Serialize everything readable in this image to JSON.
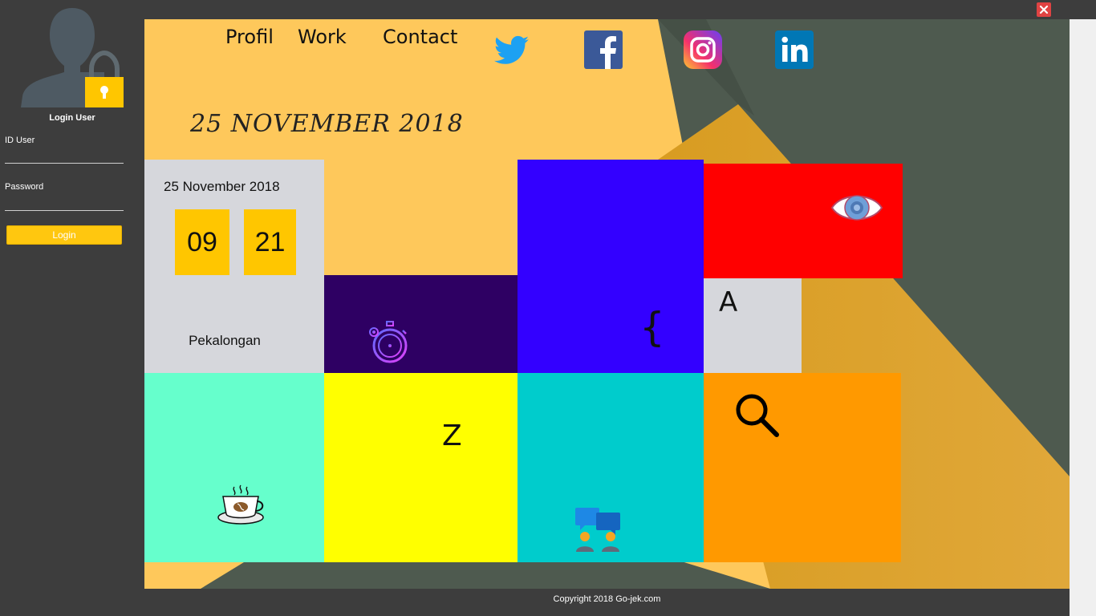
{
  "sidebar": {
    "avatar_icon": "user-lock-icon",
    "title": "Login User",
    "id_label": "ID User",
    "id_value": "",
    "password_label": "Password",
    "password_value": "",
    "login_label": "Login"
  },
  "nav": {
    "profil": "Profil",
    "work": "Work",
    "contact": "Contact"
  },
  "social": [
    "twitter-icon",
    "facebook-icon",
    "instagram-icon",
    "linkedin-icon"
  ],
  "header_date": "25 NOVEMBER 2018",
  "clock": {
    "date": "25 November 2018",
    "hour": "09",
    "minute": "21",
    "city": "Pekalongan"
  },
  "tiles": {
    "stopwatch": {
      "icon": "stopwatch-icon",
      "color": "#2e0063"
    },
    "code": {
      "glyph": "{",
      "color": "#3300ff"
    },
    "eye": {
      "icon": "eye-icon",
      "color": "#ff0000"
    },
    "font": {
      "glyph": "A",
      "color": "#d6d7dc"
    },
    "coffee": {
      "icon": "coffee-cup-icon",
      "color": "#66ffcc"
    },
    "sleep": {
      "glyph": "Z",
      "color": "#ffff00"
    },
    "chat": {
      "icon": "team-chat-icon",
      "color": "#00cccc"
    },
    "search": {
      "icon": "search-icon",
      "color": "#ff9900"
    }
  },
  "colors": {
    "accent": "#ffc600",
    "panel_bg": "#fec85b",
    "sidebar_bg": "#3d3d3d",
    "close": "#e04343"
  },
  "footer": {
    "copyright": "Copyright 2018 Go-jek.com"
  }
}
